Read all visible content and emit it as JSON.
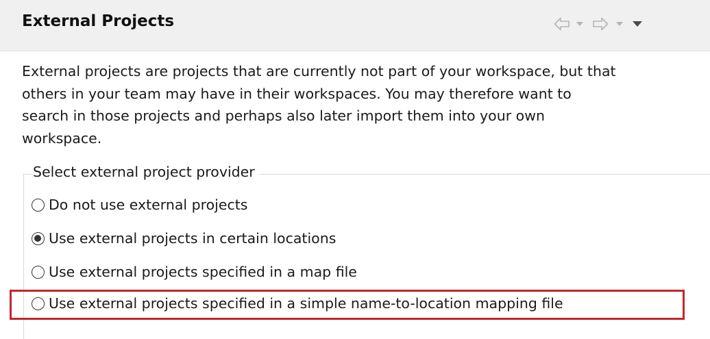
{
  "header": {
    "title": "External Projects",
    "nav": {
      "back_icon": "back-arrow-icon",
      "back_menu_icon": "chevron-down-icon",
      "forward_icon": "forward-arrow-icon",
      "forward_menu_icon": "chevron-down-icon",
      "view_menu_icon": "view-menu-icon"
    }
  },
  "description": "External projects are projects that are currently not part of your workspace, but that\nothers in your team may have in their workspaces. You may therefore want to\nsearch in those projects and perhaps also later import them into your own\nworkspace.",
  "provider_group": {
    "legend": "Select external project provider",
    "options": [
      {
        "label": "Do not use external projects",
        "selected": false
      },
      {
        "label": "Use external projects in certain locations",
        "selected": true
      },
      {
        "label": "Use external projects specified in a map file",
        "selected": false
      },
      {
        "label": "Use external projects specified in a simple name-to-location mapping file",
        "selected": false,
        "highlighted": true
      }
    ]
  },
  "colors": {
    "header_background": "#f0f0f0",
    "highlight_border": "#c1272d",
    "nav_icon_light": "#b4b4b4",
    "nav_icon_dark": "#4a4a4a",
    "text": "#1a1a1a"
  }
}
